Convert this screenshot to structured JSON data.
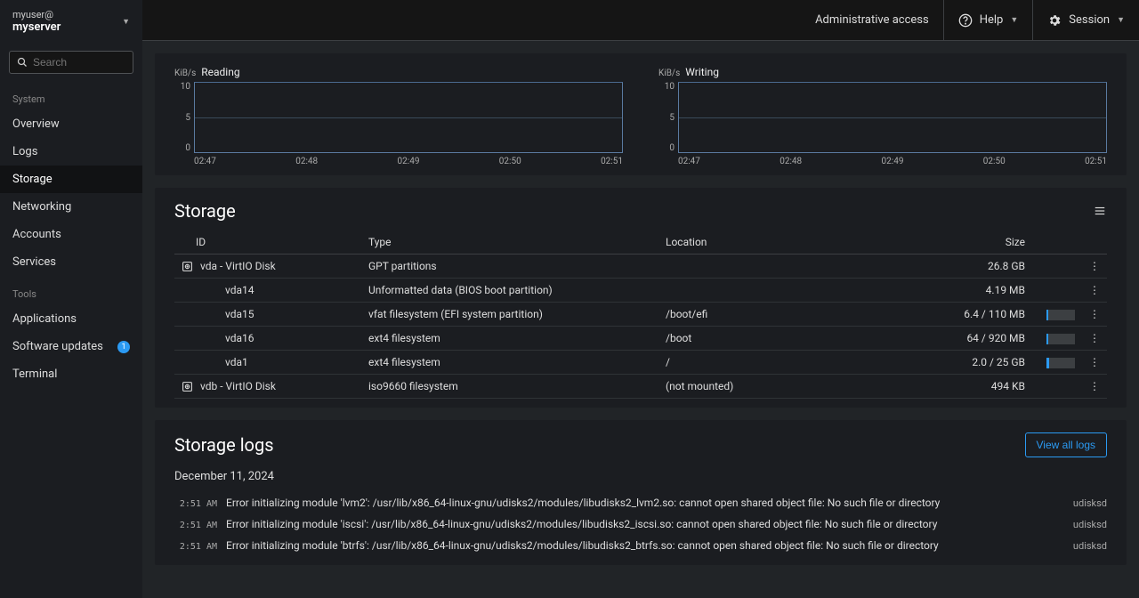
{
  "host": {
    "user": "myuser@",
    "server": "myserver"
  },
  "search": {
    "placeholder": "Search"
  },
  "nav": {
    "group1_title": "System",
    "group1": [
      "Overview",
      "Logs",
      "Storage",
      "Networking",
      "Accounts",
      "Services"
    ],
    "group2_title": "Tools",
    "group2": [
      "Applications",
      "Software updates",
      "Terminal"
    ],
    "active": "Storage",
    "updates_badge": "1"
  },
  "header": {
    "admin": "Administrative access",
    "help": "Help",
    "session": "Session"
  },
  "chart_data": [
    {
      "type": "line",
      "title": "Reading",
      "unit": "KiB/s",
      "y_ticks": [
        10,
        5,
        0
      ],
      "x_ticks": [
        "02:47",
        "02:48",
        "02:49",
        "02:50",
        "02:51"
      ],
      "ylim": [
        0,
        10
      ],
      "series": [
        {
          "name": "Reading",
          "values": [
            0,
            0,
            0,
            0,
            0
          ]
        }
      ]
    },
    {
      "type": "line",
      "title": "Writing",
      "unit": "KiB/s",
      "y_ticks": [
        10,
        5,
        0
      ],
      "x_ticks": [
        "02:47",
        "02:48",
        "02:49",
        "02:50",
        "02:51"
      ],
      "ylim": [
        0,
        10
      ],
      "series": [
        {
          "name": "Writing",
          "values": [
            0,
            0,
            0,
            0,
            0
          ]
        }
      ]
    }
  ],
  "storage": {
    "title": "Storage",
    "columns": {
      "id": "ID",
      "type": "Type",
      "location": "Location",
      "size": "Size"
    },
    "rows": [
      {
        "icon": true,
        "id": "vda - VirtIO Disk",
        "type": "GPT partitions",
        "location": "",
        "size": "26.8 GB",
        "usage": null,
        "indent": 0
      },
      {
        "icon": false,
        "id": "vda14",
        "type": "Unformatted data (BIOS boot partition)",
        "location": "",
        "size": "4.19 MB",
        "usage": null,
        "indent": 1
      },
      {
        "icon": false,
        "id": "vda15",
        "type": "vfat filesystem (EFI system partition)",
        "location": "/boot/efi",
        "size": "6.4 / 110 MB",
        "usage": 6,
        "indent": 1
      },
      {
        "icon": false,
        "id": "vda16",
        "type": "ext4 filesystem",
        "location": "/boot",
        "size": "64 / 920 MB",
        "usage": 7,
        "indent": 1
      },
      {
        "icon": false,
        "id": "vda1",
        "type": "ext4 filesystem",
        "location": "/",
        "size": "2.0 / 25 GB",
        "usage": 8,
        "indent": 1
      },
      {
        "icon": true,
        "id": "vdb - VirtIO Disk",
        "type": "iso9660 filesystem",
        "location": "(not mounted)",
        "size": "494 KB",
        "usage": null,
        "indent": 0
      }
    ]
  },
  "logs": {
    "title": "Storage logs",
    "view_all": "View all logs",
    "date": "December 11, 2024",
    "entries": [
      {
        "time": "2:51 AM",
        "msg": "Error initializing module 'lvm2': /usr/lib/x86_64-linux-gnu/udisks2/modules/libudisks2_lvm2.so: cannot open shared object file: No such file or directory",
        "src": "udisksd"
      },
      {
        "time": "2:51 AM",
        "msg": "Error initializing module 'iscsi': /usr/lib/x86_64-linux-gnu/udisks2/modules/libudisks2_iscsi.so: cannot open shared object file: No such file or directory",
        "src": "udisksd"
      },
      {
        "time": "2:51 AM",
        "msg": "Error initializing module 'btrfs': /usr/lib/x86_64-linux-gnu/udisks2/modules/libudisks2_btrfs.so: cannot open shared object file: No such file or directory",
        "src": "udisksd"
      }
    ]
  }
}
